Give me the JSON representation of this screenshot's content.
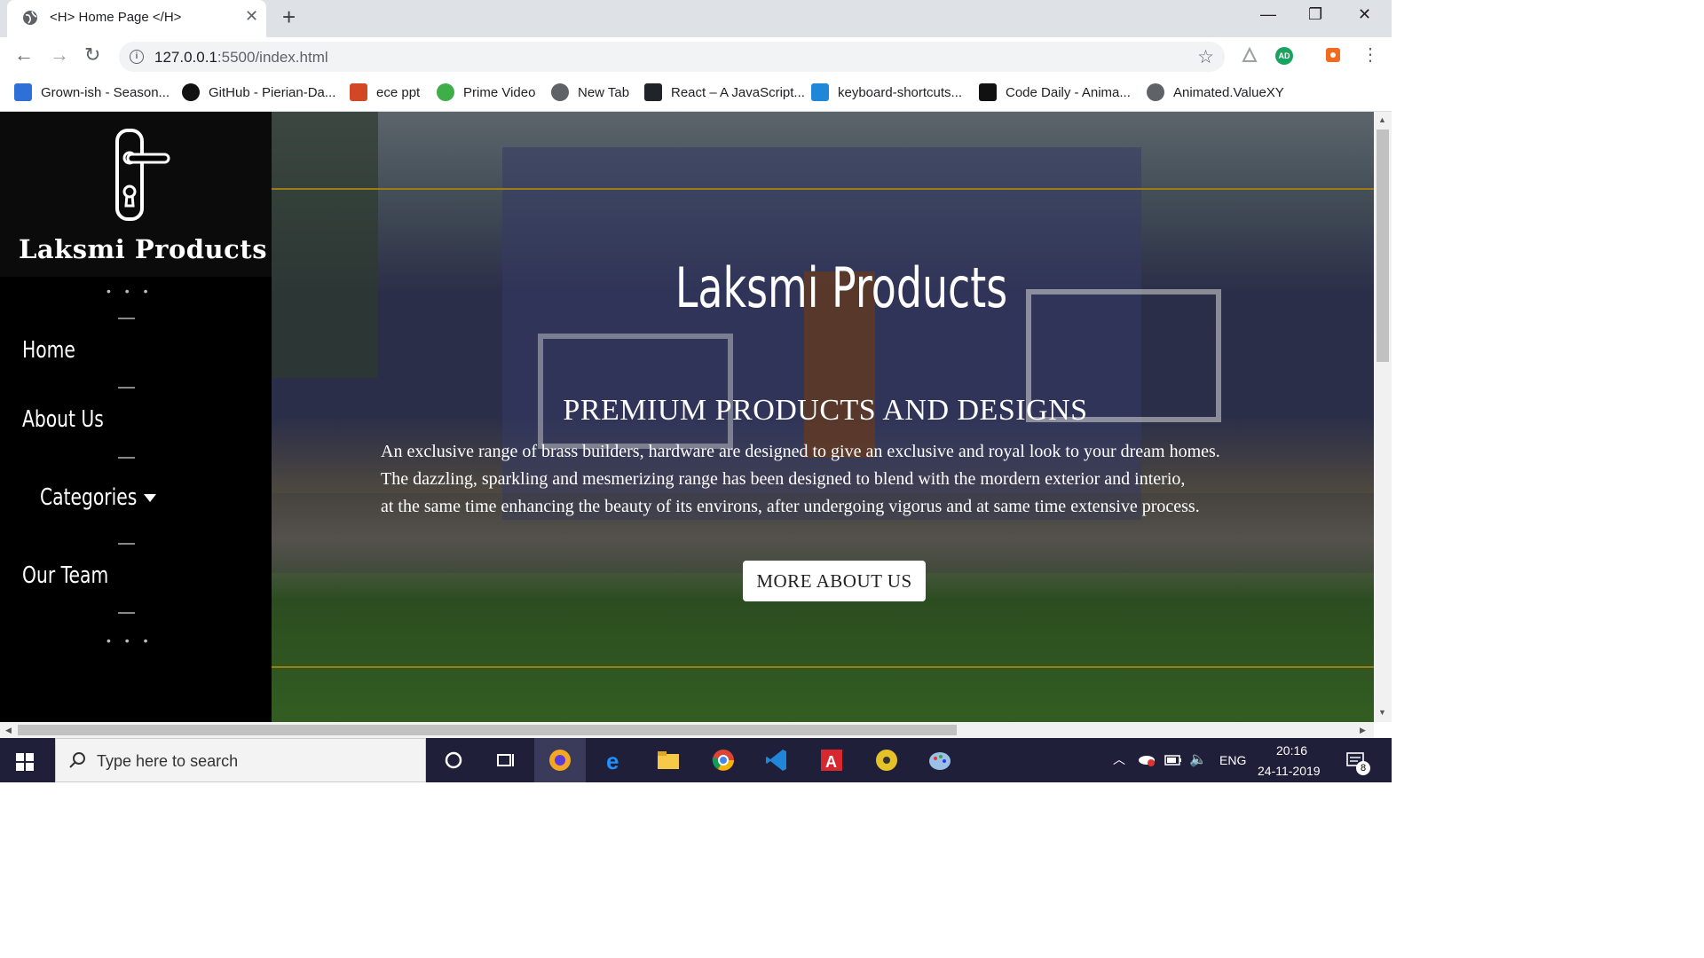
{
  "browser": {
    "tab_title": "<H> Home Page </H>",
    "close_symbol": "✕",
    "new_tab_symbol": "+",
    "window_buttons": [
      "—",
      "❐",
      "✕"
    ],
    "url_host": "127.0.0.1",
    "url_rest": ":5500/index.html",
    "profile_initials": "AD",
    "bookmarks": [
      {
        "label": "Grown-ish - Season...",
        "icon": "play-app-icon",
        "color": "#2e6fd8"
      },
      {
        "label": "GitHub - Pierian-Da...",
        "icon": "github-icon",
        "color": "#111111"
      },
      {
        "label": "ece ppt",
        "icon": "powerpoint-icon",
        "color": "#d24726"
      },
      {
        "label": "Prime Video",
        "icon": "prime-video-icon",
        "color": "#3fae49"
      },
      {
        "label": "New Tab",
        "icon": "globe-icon",
        "color": "#5f6368"
      },
      {
        "label": "React – A JavaScript...",
        "icon": "react-icon",
        "color": "#20232a"
      },
      {
        "label": "keyboard-shortcuts...",
        "icon": "vscode-icon",
        "color": "#1f86d8"
      },
      {
        "label": "Code Daily - Anima...",
        "icon": "codedaily-icon",
        "color": "#111111"
      },
      {
        "label": "Animated.ValueXY",
        "icon": "globe-icon",
        "color": "#5f6368"
      }
    ]
  },
  "site": {
    "brand": "Laksmi Products",
    "nav": {
      "home": "Home",
      "about": "About Us",
      "categories": "Categories",
      "team": "Our Team"
    },
    "dots": "• • •",
    "hero": {
      "title": "Laksmi Products",
      "subtitle": "PREMIUM PRODUCTS AND DESIGNS",
      "lines": [
        "An exclusive range of brass builders, hardware are designed to give an exclusive and royal look to your dream homes.",
        "The dazzling, sparkling and mesmerizing range has been designed to blend with the mordern exterior and interio,",
        "at the same time enhancing the beauty of its environs, after undergoing vigorus and at same time extensive process."
      ],
      "button": "MORE ABOUT US"
    },
    "colors": {
      "gold_line": "#9c7d14",
      "sidebar": "#000000"
    }
  },
  "taskbar": {
    "search_placeholder": "Type here to search",
    "language": "ENG",
    "time": "20:16",
    "date": "24-11-2019",
    "notification_count": "8"
  }
}
